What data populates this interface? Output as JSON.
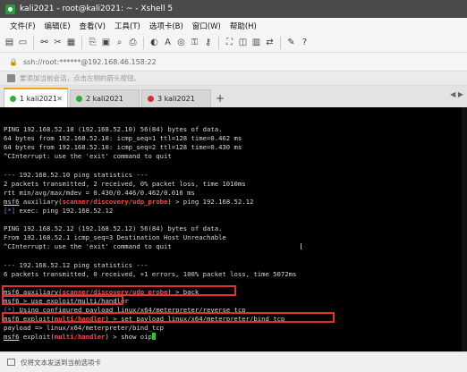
{
  "window": {
    "title": "kali2021 - root@kali2021: ~ - Xshell 5"
  },
  "menu": [
    "文件(F)",
    "编辑(E)",
    "查看(V)",
    "工具(T)",
    "选项卡(B)",
    "窗口(W)",
    "帮助(H)"
  ],
  "toolbar_icons": [
    "new-session-icon",
    "open-folder-icon",
    "link-icon",
    "disconnect-icon",
    "properties-icon",
    "copy-icon",
    "paste-icon",
    "find-icon",
    "print-icon",
    "color-scheme-icon",
    "font-icon",
    "globe-icon",
    "lock-icon",
    "key-icon",
    "fullscreen-icon",
    "transparent-icon",
    "layout-icon",
    "tunnel-icon",
    "compose-icon",
    "help-icon"
  ],
  "address": {
    "text": "ssh://root:******@192.168.46.158:22"
  },
  "hint": {
    "text": "要添加当前会话，点击左侧的箭头按钮。"
  },
  "tabs": [
    {
      "label": "1 kali2021",
      "active": true,
      "dot_color": "#2fb02f"
    },
    {
      "label": "2 kali2021",
      "active": false,
      "dot_color": "#2fb02f"
    },
    {
      "label": "3 kali2021",
      "active": false,
      "dot_color": "#d03030"
    }
  ],
  "terminal": {
    "lines": [
      "",
      "",
      "PING 192.168.52.10 (192.168.52.10) 56(84) bytes of data.",
      "64 bytes from 192.168.52.10: icmp_seq=1 ttl=128 time=0.462 ms",
      "64 bytes from 192.168.52.10: icmp_seq=2 ttl=128 time=0.430 ms",
      "^CInterrupt: use the 'exit' command to quit",
      "",
      "--- 192.168.52.10 ping statistics ---",
      "2 packets transmitted, 2 received, 0% packet loss, time 1010ms",
      "rtt min/avg/max/mdev = 0.430/0.446/0.462/0.016 ms",
      "msf6 auxiliary(scanner/discovery/udp_probe) > ping 192.168.52.12",
      "[*] exec: ping 192.168.52.12",
      "",
      "PING 192.168.52.12 (192.168.52.12) 56(84) bytes of data.",
      "From 192.168.52.1 icmp_seq=3 Destination Host Unreachable",
      "^CInterrupt: use the 'exit' command to quit",
      "",
      "--- 192.168.52.12 ping statistics ---",
      "6 packets transmitted, 0 received, +1 errors, 100% packet loss, time 5072ms",
      "",
      "msf6 auxiliary(scanner/discovery/udp_probe) > back",
      "msf6 > use exploit/multi/handler",
      "[*] Using configured payload linux/x64/meterpreter/reverse_tcp",
      "msf6 exploit(multi/handler) > set payload linux/x64/meterpreter/bind_tcp",
      "payload => linux/x64/meterpreter/bind_tcp",
      "msf6 exploit(multi/handler) > show oip"
    ]
  },
  "status": {
    "text": "仅将文本发送到当前选项卡"
  }
}
